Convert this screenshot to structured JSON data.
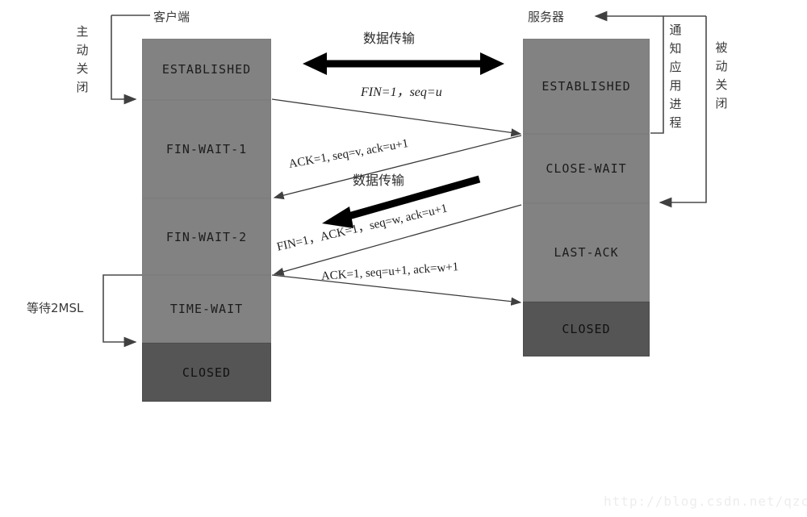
{
  "diagram": {
    "title_client": "客户端",
    "title_server": "服务器",
    "client_annotation": "主动关闭",
    "client_annotation_chars": [
      "主",
      "动",
      "关",
      "闭"
    ],
    "server_annotation": "被动关闭",
    "server_annotation_chars": [
      "被",
      "动",
      "关",
      "闭"
    ],
    "notify_app_annotation": "通知应用进程",
    "notify_app_chars": [
      "通",
      "知",
      "应",
      "用",
      "进",
      "程"
    ],
    "wait_label": "等待2MSL",
    "data_transfer_top": "数据传输",
    "data_transfer_mid": "数据传输",
    "watermark": "http://blog.csdn.net/qzcsu"
  },
  "client_states": [
    {
      "label": "ESTABLISHED",
      "kind": "active"
    },
    {
      "label": "FIN-WAIT-1",
      "kind": "active"
    },
    {
      "label": "FIN-WAIT-2",
      "kind": "active"
    },
    {
      "label": "TIME-WAIT",
      "kind": "active"
    },
    {
      "label": "CLOSED",
      "kind": "closed"
    }
  ],
  "server_states": [
    {
      "label": "ESTABLISHED",
      "kind": "active"
    },
    {
      "label": "CLOSE-WAIT",
      "kind": "active"
    },
    {
      "label": "LAST-ACK",
      "kind": "active"
    },
    {
      "label": "CLOSED",
      "kind": "closed"
    }
  ],
  "messages": [
    {
      "id": "msg1",
      "label": "FIN=1，seq=u",
      "direction": "client-to-server"
    },
    {
      "id": "msg2",
      "label": "ACK=1, seq=v, ack=u+1",
      "direction": "server-to-client"
    },
    {
      "id": "msg3",
      "label": "FIN=1，ACK=1，seq=w, ack=u+1",
      "direction": "server-to-client"
    },
    {
      "id": "msg4",
      "label": "ACK=1, seq=u+1, ack=w+1",
      "direction": "client-to-server"
    }
  ],
  "colors": {
    "state_fill": "#828282",
    "closed_fill": "#555555",
    "border": "#7d7d7d",
    "line": "#404040",
    "thick_arrow": "#000000",
    "watermark": "#ededed"
  }
}
